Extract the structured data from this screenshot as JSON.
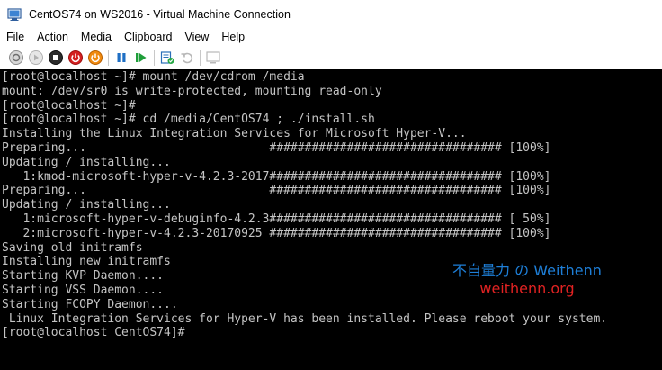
{
  "window": {
    "title": "CentOS74 on WS2016 - Virtual Machine Connection"
  },
  "menu": {
    "items": [
      "File",
      "Action",
      "Media",
      "Clipboard",
      "View",
      "Help"
    ]
  },
  "toolbar": {
    "buttons": [
      "ctrl-alt-del",
      "start",
      "turn-off",
      "shut-down",
      "save",
      "pause",
      "reset",
      "checkpoint",
      "revert",
      "enhanced-session"
    ]
  },
  "console": {
    "lines": [
      "[root@localhost ~]# mount /dev/cdrom /media",
      "mount: /dev/sr0 is write-protected, mounting read-only",
      "[root@localhost ~]#",
      "[root@localhost ~]# cd /media/CentOS74 ; ./install.sh",
      "Installing the Linux Integration Services for Microsoft Hyper-V...",
      "Preparing...                          ################################# [100%]",
      "Updating / installing...",
      "   1:kmod-microsoft-hyper-v-4.2.3-2017################################# [100%]",
      "Preparing...                          ################################# [100%]",
      "Updating / installing...",
      "   1:microsoft-hyper-v-debuginfo-4.2.3################################# [ 50%]",
      "   2:microsoft-hyper-v-4.2.3-20170925 ################################# [100%]",
      "Saving old initramfs",
      "Installing new initramfs",
      "Starting KVP Daemon....",
      "Starting VSS Daemon....",
      "Starting FCOPY Daemon....",
      " Linux Integration Services for Hyper-V has been installed. Please reboot your system.",
      "[root@localhost CentOS74]#"
    ]
  },
  "watermark": {
    "line1": "不自量力 の Weithenn",
    "line2": "weithenn.org"
  },
  "colors": {
    "console_bg": "#000000",
    "console_fg": "#c4c4c4",
    "watermark_blue": "#1e7fd8",
    "watermark_red": "#e02222"
  }
}
